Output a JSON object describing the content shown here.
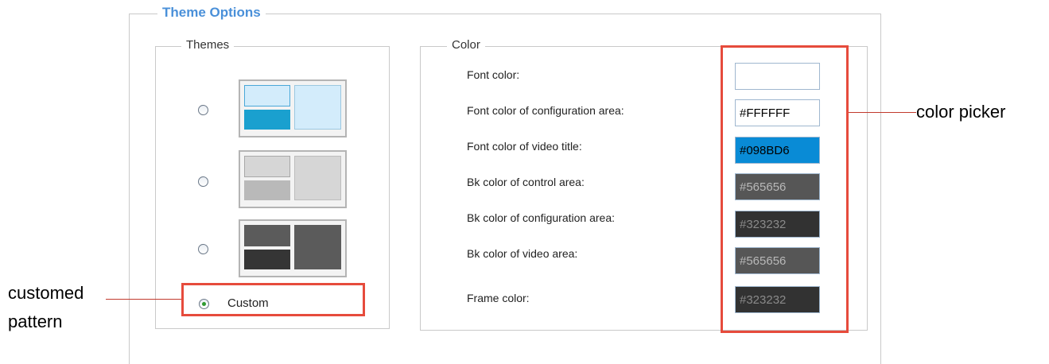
{
  "theme_options": {
    "title": "Theme Options",
    "themes": {
      "legend": "Themes",
      "presets": [
        {
          "name": "blue",
          "selected": false,
          "colors": {
            "a": "#d3ecfb",
            "b": "#1aa0cf",
            "c": "#d3ecfb",
            "a_border": "#4aa8d8",
            "c_border": "#9cc8e0"
          }
        },
        {
          "name": "gray",
          "selected": false,
          "colors": {
            "a": "#d6d6d6",
            "b": "#b9b9b9",
            "c": "#d6d6d6",
            "a_border": "#a8a8a8",
            "c_border": "#bdbdbd"
          }
        },
        {
          "name": "dark",
          "selected": false,
          "colors": {
            "a": "#5b5b5b",
            "b": "#353535",
            "c": "#5b5b5b",
            "a_border": "#5b5b5b",
            "c_border": "#5b5b5b"
          }
        }
      ],
      "custom": {
        "label": "Custom",
        "selected": true
      }
    },
    "color": {
      "legend": "Color",
      "fields": [
        {
          "label": "Font color:",
          "value": "",
          "bg": "#ffffff",
          "fg": "#000000"
        },
        {
          "label": "Font color of configuration area:",
          "value": "#FFFFFF",
          "bg": "#ffffff",
          "fg": "#000000"
        },
        {
          "label": "Font color of video title:",
          "value": "#098BD6",
          "bg": "#098bd6",
          "fg": "#000000"
        },
        {
          "label": "Bk color of control area:",
          "value": "#565656",
          "bg": "#565656",
          "fg": "#b8b8b8"
        },
        {
          "label": "Bk color of configuration area:",
          "value": "#323232",
          "bg": "#323232",
          "fg": "#8a8a8a"
        },
        {
          "label": "Bk color of video area:",
          "value": "#565656",
          "bg": "#565656",
          "fg": "#b8b8b8"
        },
        {
          "label": "Frame color:",
          "value": "#323232",
          "bg": "#323232",
          "fg": "#8a8a8a"
        }
      ]
    }
  },
  "annotations": {
    "color_picker": "color picker",
    "customed_pattern_line1": "customed",
    "customed_pattern_line2": "pattern",
    "highlight_color": "#e64b3c"
  }
}
